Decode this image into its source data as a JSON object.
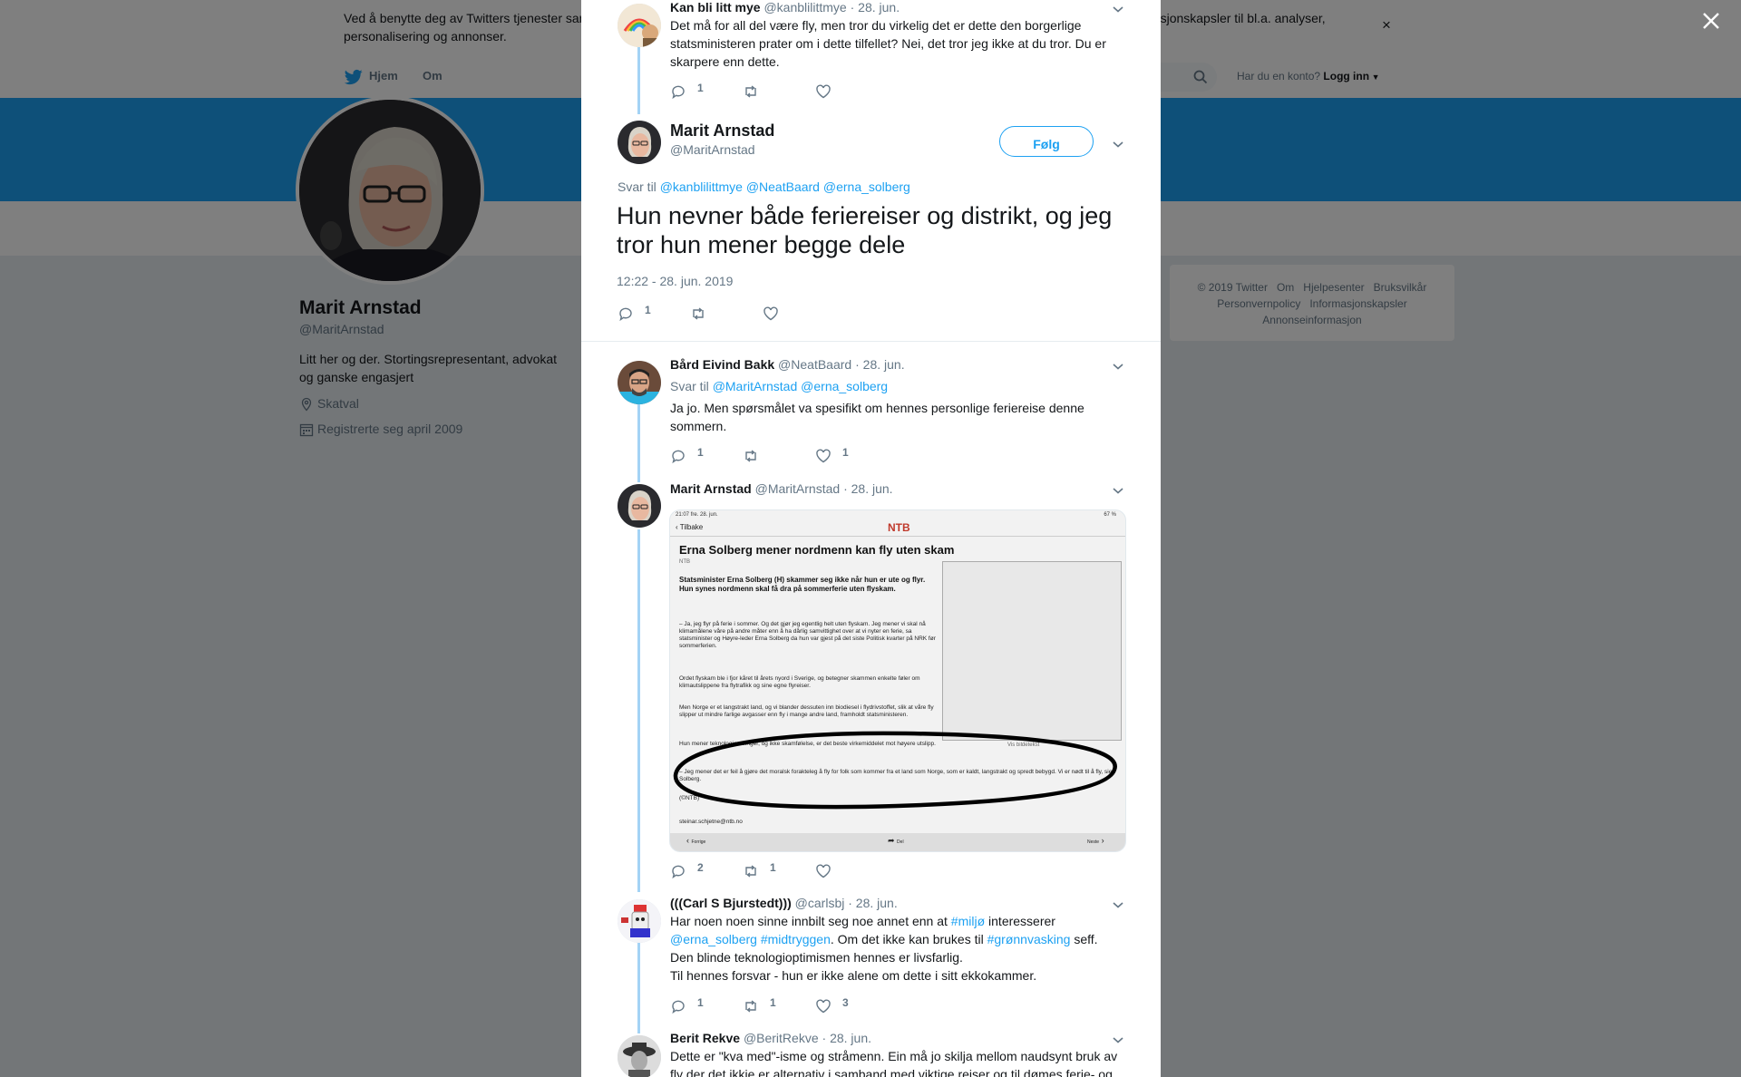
{
  "cookie": {
    "text": "Ved å benytte deg av Twitters tjenester samtykker du til vår bruk av informasjonskapsler og overføring av data. Vi og våre partnere bruker informasjonskapsler til bl.a. analyser, personalisering og annonser.",
    "close": "×"
  },
  "nav": {
    "home": "Hjem",
    "about": "Om",
    "login_prompt": "Har du en konto?",
    "login": "Logg inn"
  },
  "profile": {
    "name": "Marit Arnstad",
    "handle": "@MaritArnstad",
    "bio": "Litt her og der. Stortingsrepresentant, advokat og ganske engasjert",
    "location": "Skatval",
    "joined": "Registrerte seg april 2009"
  },
  "footer": {
    "links": [
      "© 2019 Twitter",
      "Om",
      "Hjelpesenter",
      "Bruksvilkår",
      "Personvernpolicy",
      "Informasjonskapsler",
      "Annonseinformasjon"
    ]
  },
  "colors": {
    "accent": "#1da1f2",
    "overlay": "rgba(0,0,0,0.5)",
    "thread_line": "#a3d3f5"
  },
  "thread": {
    "parent": {
      "name": "Kan bli litt mye",
      "handle": "@kanblilittmye",
      "date": "28. jun.",
      "text": "Det må for all del være fly, men tror du virkelig det er dette den borgerlige statsministeren prater om i dette tilfellet? Nei, det tror jeg ikke at du tror. Du er skarpere enn dette.",
      "replies": "1",
      "retweets": "",
      "likes": ""
    },
    "main": {
      "name": "Marit Arnstad",
      "handle": "@MaritArnstad",
      "follow": "Følg",
      "reply_to_label": "Svar til",
      "reply_to": [
        "@kanblilittmye",
        "@NeatBaard",
        "@erna_solberg"
      ],
      "text": "Hun nevner både feriereiser og distrikt, og jeg tror hun mener begge dele",
      "time": "12:22 - 28. jun. 2019",
      "replies": "1",
      "retweets": "",
      "likes": ""
    },
    "replies": [
      {
        "name": "Bård Eivind Bakk",
        "handle": "@NeatBaard",
        "date": "28. jun.",
        "reply_to_label": "Svar til",
        "reply_to": [
          "@MaritArnstad",
          "@erna_solberg"
        ],
        "text": "Ja jo. Men spørsmålet va spesifikt om hennes personlige feriereise denne sommern.",
        "replies": "1",
        "retweets": "",
        "likes": "1"
      },
      {
        "name": "Marit Arnstad",
        "handle": "@MaritArnstad",
        "date": "28. jun.",
        "replies": "2",
        "retweets": "1",
        "likes": ""
      },
      {
        "name": "(((Carl S Bjurstedt)))",
        "handle": "@carlsbj",
        "date": "28. jun.",
        "text_parts": [
          "Har noen noen sinne innbilt seg noe annet enn at ",
          "#miljø",
          " interesserer",
          "@erna_solberg",
          "#midtryggen",
          ". Om det ikke kan brukes til ",
          "#grønnvasking",
          " seff.",
          "Den blinde teknologioptimismen hennes er livsfarlig.",
          "Til hennes forsvar - hun er ikke alene om dette i sitt ekkokammer."
        ],
        "replies": "1",
        "retweets": "1",
        "likes": "3"
      },
      {
        "name": "Berit Rekve",
        "handle": "@BeritRekve",
        "date": "28. jun.",
        "text": "Dette er \"kva med\"-isme og stråmenn. Ein må jo skilja mellom naudsynt bruk av fly der det ikkje er alternativ i samband med viktige reiser og til dømes ferie- og"
      }
    ]
  },
  "news_screenshot": {
    "status_time": "21:07",
    "status_date": "fre. 28. jun.",
    "status_right": "67 %",
    "back": "Tilbake",
    "brand": "NTB",
    "headline": "Erna Solberg mener nordmenn kan fly uten skam",
    "source": "NTB",
    "lead": "Statsminister Erna Solberg (H) skammer seg ikke når hun er ute og flyr. Hun synes nordmenn skal få dra på sommerferie uten flyskam.",
    "p1": "– Ja, jeg flyr på ferie i sommer. Og det gjør jeg egentlig helt uten flyskam. Jeg mener vi skal nå klimamålene våre på andre måter enn å ha dårlig samvittighet over at vi nyter en ferie, sa statsminister og Høyre-leder Erna Solberg da hun var gjest på det siste Politisk kvarter på NRK før sommerferien.",
    "p2": "Ordet flyskam ble i fjor kåret til årets nyord i Sverige, og betegner skammen enkelte føler om klimautslippene fra flytrafikk og sine egne flyreiser.",
    "p3": "Men Norge er et langstrakt land, og vi blander dessuten inn biodiesel i flydrivstoffet, slik at våre fly slipper ut mindre farlige avgasser enn fly i mange andre land, framholdt statsministeren.",
    "p4": "Hun mener teknologiendringer, og ikke skamfølelse, er det beste virkemiddelet mot høyere utslipp.",
    "p5": "– Jeg mener det er feil å gjøre det moralsk forakteleg å fly for folk som kommer fra et land som Norge, som er kaldt, langstrakt og spredt bebygd. Vi er nødt til å fly, sier Solberg.",
    "p6": "(©NTB)",
    "email": "steinar.schjetne@ntb.no",
    "image_caption": "Vis bildetekst",
    "nav_prev": "Forrige",
    "nav_share": "Del",
    "nav_next": "Neste"
  }
}
